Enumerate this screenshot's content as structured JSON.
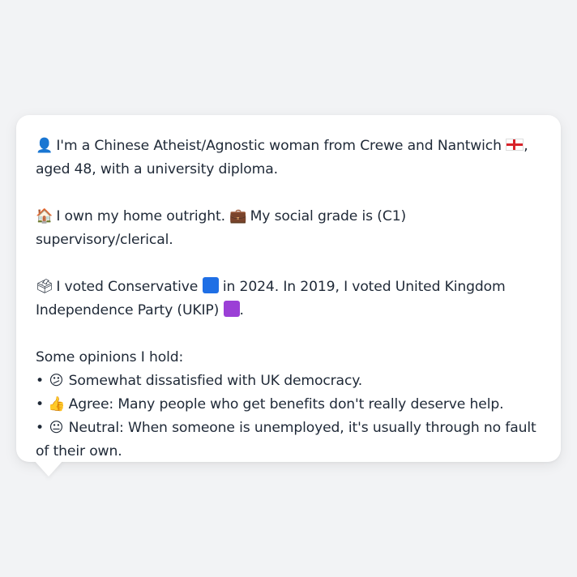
{
  "profile": {
    "line1_pre": "I'm a Chinese Atheist/Agnostic woman from Crewe and Nantwich",
    "line1_post": ", aged 48, with a university diploma.",
    "home": "I own my home outright.",
    "grade": "My social grade is (C1) supervisory/clerical.",
    "vote_pre": "I voted Conservative",
    "vote_mid": "in 2024. In 2019, I voted United Kingdom Independence Party (UKIP)",
    "vote_post": ".",
    "opinions_heading": "Some opinions I hold:",
    "opinions": [
      {
        "bullet": "•",
        "text": "Somewhat dissatisfied with UK democracy."
      },
      {
        "bullet": "•",
        "text": "Agree: Many people who get benefits don't really deserve help."
      },
      {
        "bullet": "•",
        "text": "Neutral: When someone is unemployed, it's usually through no fault of their own."
      }
    ]
  },
  "icons": {
    "person": "👤",
    "house": "🏠",
    "briefcase": "💼",
    "ballot": "🗳",
    "confused": "😕",
    "thumbs": "👍",
    "neutral": "😐"
  },
  "colors": {
    "conservative": "#1f6fe5",
    "ukip": "#9b3fd6",
    "flag_cross": "#d8232a"
  }
}
